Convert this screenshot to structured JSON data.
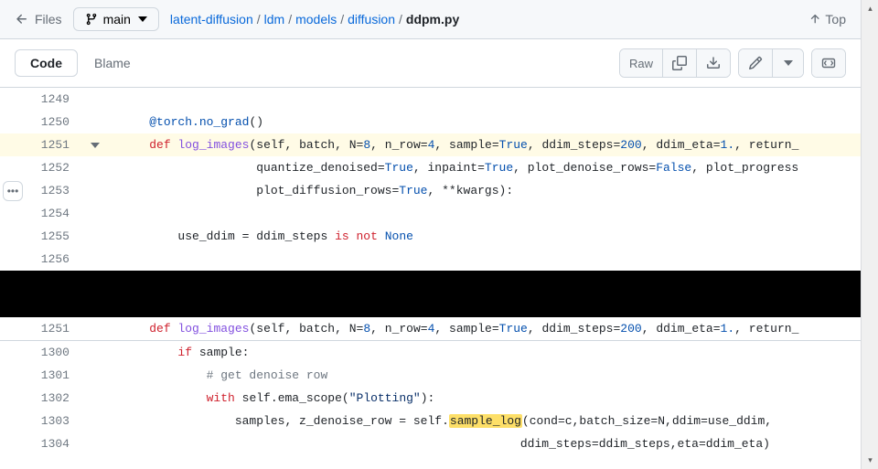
{
  "header": {
    "files_label": "Files",
    "branch": "main",
    "top_label": "Top"
  },
  "breadcrumb": {
    "parts": [
      "latent-diffusion",
      "ldm",
      "models",
      "diffusion"
    ],
    "current": "ddpm.py"
  },
  "tabs": {
    "code": "Code",
    "blame": "Blame"
  },
  "toolbar": {
    "raw": "Raw"
  },
  "code_top": {
    "lines": [
      {
        "no": "1249",
        "tokens": []
      },
      {
        "no": "1250",
        "tokens": [
          {
            "t": "    ",
            "c": ""
          },
          {
            "t": "@torch.no_grad",
            "c": "hl-at"
          },
          {
            "t": "()",
            "c": ""
          }
        ]
      },
      {
        "no": "1251",
        "hl": true,
        "chev": true,
        "tokens": [
          {
            "t": "    ",
            "c": ""
          },
          {
            "t": "def",
            "c": "hl-def"
          },
          {
            "t": " ",
            "c": ""
          },
          {
            "t": "log_images",
            "c": "hl-fn"
          },
          {
            "t": "(",
            "c": ""
          },
          {
            "t": "self",
            "c": ""
          },
          {
            "t": ", ",
            "c": ""
          },
          {
            "t": "batch",
            "c": ""
          },
          {
            "t": ", ",
            "c": ""
          },
          {
            "t": "N",
            "c": ""
          },
          {
            "t": "=",
            "c": ""
          },
          {
            "t": "8",
            "c": "hl-num"
          },
          {
            "t": ", ",
            "c": ""
          },
          {
            "t": "n_row",
            "c": ""
          },
          {
            "t": "=",
            "c": ""
          },
          {
            "t": "4",
            "c": "hl-num"
          },
          {
            "t": ", ",
            "c": ""
          },
          {
            "t": "sample",
            "c": ""
          },
          {
            "t": "=",
            "c": ""
          },
          {
            "t": "True",
            "c": "hl-val"
          },
          {
            "t": ", ",
            "c": ""
          },
          {
            "t": "ddim_steps",
            "c": ""
          },
          {
            "t": "=",
            "c": ""
          },
          {
            "t": "200",
            "c": "hl-num"
          },
          {
            "t": ", ",
            "c": ""
          },
          {
            "t": "ddim_eta",
            "c": ""
          },
          {
            "t": "=",
            "c": ""
          },
          {
            "t": "1.",
            "c": "hl-num"
          },
          {
            "t": ", ",
            "c": ""
          },
          {
            "t": "return_",
            "c": ""
          }
        ]
      },
      {
        "no": "1252",
        "tokens": [
          {
            "t": "                   ",
            "c": ""
          },
          {
            "t": "quantize_denoised",
            "c": ""
          },
          {
            "t": "=",
            "c": ""
          },
          {
            "t": "True",
            "c": "hl-val"
          },
          {
            "t": ", ",
            "c": ""
          },
          {
            "t": "inpaint",
            "c": ""
          },
          {
            "t": "=",
            "c": ""
          },
          {
            "t": "True",
            "c": "hl-val"
          },
          {
            "t": ", ",
            "c": ""
          },
          {
            "t": "plot_denoise_rows",
            "c": ""
          },
          {
            "t": "=",
            "c": ""
          },
          {
            "t": "False",
            "c": "hl-val"
          },
          {
            "t": ", ",
            "c": ""
          },
          {
            "t": "plot_progress",
            "c": ""
          }
        ]
      },
      {
        "no": "1253",
        "tokens": [
          {
            "t": "                   ",
            "c": ""
          },
          {
            "t": "plot_diffusion_rows",
            "c": ""
          },
          {
            "t": "=",
            "c": ""
          },
          {
            "t": "True",
            "c": "hl-val"
          },
          {
            "t": ", **",
            "c": ""
          },
          {
            "t": "kwargs",
            "c": ""
          },
          {
            "t": "):",
            "c": ""
          }
        ]
      },
      {
        "no": "1254",
        "tokens": []
      },
      {
        "no": "1255",
        "tokens": [
          {
            "t": "        ",
            "c": ""
          },
          {
            "t": "use_ddim",
            "c": ""
          },
          {
            "t": " = ",
            "c": ""
          },
          {
            "t": "ddim_steps",
            "c": ""
          },
          {
            "t": " ",
            "c": ""
          },
          {
            "t": "is",
            "c": "hl-kw"
          },
          {
            "t": " ",
            "c": ""
          },
          {
            "t": "not",
            "c": "hl-kw"
          },
          {
            "t": " ",
            "c": ""
          },
          {
            "t": "None",
            "c": "hl-val"
          }
        ]
      },
      {
        "no": "1256",
        "tokens": []
      }
    ]
  },
  "sticky": {
    "no": "1251",
    "tokens": [
      {
        "t": "    ",
        "c": ""
      },
      {
        "t": "def",
        "c": "hl-def"
      },
      {
        "t": " ",
        "c": ""
      },
      {
        "t": "log_images",
        "c": "hl-fn"
      },
      {
        "t": "(",
        "c": ""
      },
      {
        "t": "self",
        "c": ""
      },
      {
        "t": ", ",
        "c": ""
      },
      {
        "t": "batch",
        "c": ""
      },
      {
        "t": ", ",
        "c": ""
      },
      {
        "t": "N",
        "c": ""
      },
      {
        "t": "=",
        "c": ""
      },
      {
        "t": "8",
        "c": "hl-num"
      },
      {
        "t": ", ",
        "c": ""
      },
      {
        "t": "n_row",
        "c": ""
      },
      {
        "t": "=",
        "c": ""
      },
      {
        "t": "4",
        "c": "hl-num"
      },
      {
        "t": ", ",
        "c": ""
      },
      {
        "t": "sample",
        "c": ""
      },
      {
        "t": "=",
        "c": ""
      },
      {
        "t": "True",
        "c": "hl-val"
      },
      {
        "t": ", ",
        "c": ""
      },
      {
        "t": "ddim_steps",
        "c": ""
      },
      {
        "t": "=",
        "c": ""
      },
      {
        "t": "200",
        "c": "hl-num"
      },
      {
        "t": ", ",
        "c": ""
      },
      {
        "t": "ddim_eta",
        "c": ""
      },
      {
        "t": "=",
        "c": ""
      },
      {
        "t": "1.",
        "c": "hl-num"
      },
      {
        "t": ", ",
        "c": ""
      },
      {
        "t": "return_",
        "c": ""
      }
    ]
  },
  "code_bottom": {
    "lines": [
      {
        "no": "1300",
        "tokens": [
          {
            "t": "        ",
            "c": ""
          },
          {
            "t": "if",
            "c": "hl-kw"
          },
          {
            "t": " ",
            "c": ""
          },
          {
            "t": "sample",
            "c": ""
          },
          {
            "t": ":",
            "c": ""
          }
        ]
      },
      {
        "no": "1301",
        "tokens": [
          {
            "t": "            ",
            "c": ""
          },
          {
            "t": "# get denoise row",
            "c": "hl-cmt"
          }
        ]
      },
      {
        "no": "1302",
        "tokens": [
          {
            "t": "            ",
            "c": ""
          },
          {
            "t": "with",
            "c": "hl-kw"
          },
          {
            "t": " ",
            "c": ""
          },
          {
            "t": "self",
            "c": ""
          },
          {
            "t": ".",
            "c": ""
          },
          {
            "t": "ema_scope",
            "c": ""
          },
          {
            "t": "(",
            "c": ""
          },
          {
            "t": "\"Plotting\"",
            "c": "hl-str"
          },
          {
            "t": "):",
            "c": ""
          }
        ]
      },
      {
        "no": "1303",
        "tokens": [
          {
            "t": "                ",
            "c": ""
          },
          {
            "t": "samples",
            "c": ""
          },
          {
            "t": ", ",
            "c": ""
          },
          {
            "t": "z_denoise_row",
            "c": ""
          },
          {
            "t": " = ",
            "c": ""
          },
          {
            "t": "self",
            "c": ""
          },
          {
            "t": ".",
            "c": ""
          },
          {
            "t": "sample_log",
            "c": "hl-match"
          },
          {
            "t": "(",
            "c": ""
          },
          {
            "t": "cond",
            "c": ""
          },
          {
            "t": "=",
            "c": ""
          },
          {
            "t": "c",
            "c": ""
          },
          {
            "t": ",",
            "c": ""
          },
          {
            "t": "batch_size",
            "c": ""
          },
          {
            "t": "=",
            "c": ""
          },
          {
            "t": "N",
            "c": ""
          },
          {
            "t": ",",
            "c": ""
          },
          {
            "t": "ddim",
            "c": ""
          },
          {
            "t": "=",
            "c": ""
          },
          {
            "t": "use_ddim",
            "c": ""
          },
          {
            "t": ",",
            "c": ""
          }
        ]
      },
      {
        "no": "1304",
        "tokens": [
          {
            "t": "                                                        ",
            "c": ""
          },
          {
            "t": "ddim_steps",
            "c": ""
          },
          {
            "t": "=",
            "c": ""
          },
          {
            "t": "ddim_steps",
            "c": ""
          },
          {
            "t": ",",
            "c": ""
          },
          {
            "t": "eta",
            "c": ""
          },
          {
            "t": "=",
            "c": ""
          },
          {
            "t": "ddim_eta",
            "c": ""
          },
          {
            "t": ")",
            "c": ""
          }
        ]
      }
    ]
  },
  "icons": {
    "dots": "•••"
  }
}
